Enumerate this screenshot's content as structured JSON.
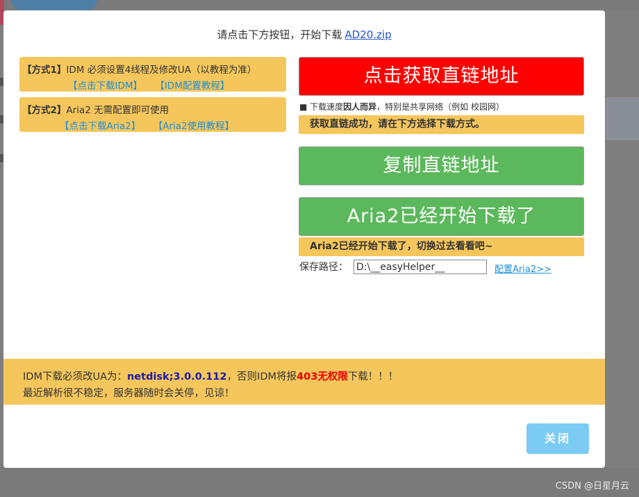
{
  "dialog": {
    "title_prefix": "请点击下方按钮，开始下载",
    "file_link": "AD20.zip"
  },
  "methods": [
    {
      "tag": "【方式1】",
      "desc": "IDM 必须设置4线程及修改UA（以教程为准）",
      "link_download": "【点击下载IDM】",
      "link_tutorial": "【IDM配置教程】"
    },
    {
      "tag": "【方式2】",
      "desc": "Aria2 无需配置即可使用",
      "link_download": "【点击下载Aria2】",
      "link_tutorial": "【Aria2使用教程】"
    }
  ],
  "actions": {
    "get_link_label": "点击获取直链地址",
    "speed_note_prefix": "■ 下载速度",
    "speed_note_bold": "因人而异",
    "speed_note_suffix": "，特别是共享网络（例如 校园网）",
    "success_msg": "获取直链成功，请在下方选择下载方式。",
    "copy_link_label": "复制直链地址",
    "aria2_label": "Aria2已经开始下载了",
    "aria2_msg": "Aria2已经开始下载了，切换过去看看吧~",
    "save_path_label": "保存路径：",
    "save_path_value": "D:\\__easyHelper__",
    "config_aria2_link": "配置Aria2>>"
  },
  "notice": {
    "line1_prefix": "IDM下载必须改UA为：",
    "ua_value": "netdisk;3.0.0.112",
    "line1_mid": "，否则IDM将报",
    "error_code": "403无权限",
    "line1_suffix": "下载！！！",
    "line2": "最近解析很不稳定，服务器随时会关停，见谅！"
  },
  "close_label": "关闭",
  "watermark": "CSDN @日星月云",
  "colors": {
    "red_button": "#ff0000",
    "green_button": "#5cb85c",
    "notice_bg": "#f5c65c",
    "link": "#1a8fd8",
    "close_button": "#7ccbf5"
  }
}
